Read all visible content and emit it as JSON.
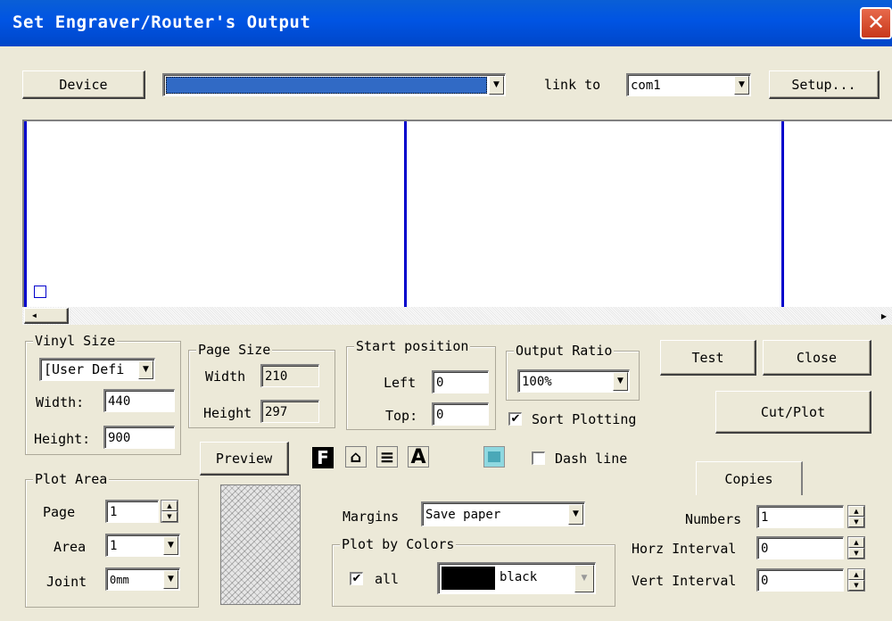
{
  "window": {
    "title": "Set Engraver/Router's Output",
    "close_glyph": "✕"
  },
  "toolbar": {
    "device_button": "Device",
    "device_select_value": "",
    "link_to_label": "link to",
    "link_to_value": "com1",
    "setup_button": "Setup..."
  },
  "vinyl_size": {
    "title": "Vinyl Size",
    "preset": "[User Defi",
    "width_label": "Width:",
    "width_value": "440",
    "height_label": "Height:",
    "height_value": "900"
  },
  "page_size": {
    "title": "Page Size",
    "width_label": "Width",
    "width_value": "210",
    "height_label": "Height",
    "height_value": "297"
  },
  "start_position": {
    "title": "Start position",
    "left_label": "Left",
    "left_value": "0",
    "top_label": "Top:",
    "top_value": "0"
  },
  "output_ratio": {
    "title": "Output Ratio",
    "value": "100%"
  },
  "sort_plotting": {
    "label": "Sort Plotting",
    "checked": true,
    "mark": "✔"
  },
  "buttons": {
    "test": "Test",
    "close": "Close",
    "cut_plot": "Cut/Plot",
    "preview": "Preview"
  },
  "tool_icons": [
    "font-f-icon",
    "node-icon",
    "align-lines-icon",
    "text-a-icon",
    "image-icon"
  ],
  "dash_line": {
    "label": "Dash line",
    "checked": false
  },
  "plot_area": {
    "title": "Plot Area",
    "page_label": "Page",
    "page_value": "1",
    "area_label": "Area",
    "area_value": "1",
    "joint_label": "Joint",
    "joint_value": "0mm"
  },
  "margins": {
    "label": "Margins",
    "value": "Save paper"
  },
  "plot_by_colors": {
    "title": "Plot by Colors",
    "all_label": "all",
    "all_checked": true,
    "all_mark": "✔",
    "color_name": "black",
    "color_swatch": "#000000"
  },
  "copies": {
    "tab": "Copies",
    "numbers_label": "Numbers",
    "numbers_value": "1",
    "horz_label": "Horz Interval",
    "horz_value": "0",
    "vert_label": "Vert Interval",
    "vert_value": "0"
  },
  "colors": {
    "accent": "#0054e3",
    "page_line": "#0000cc",
    "face": "#ece9d8"
  }
}
